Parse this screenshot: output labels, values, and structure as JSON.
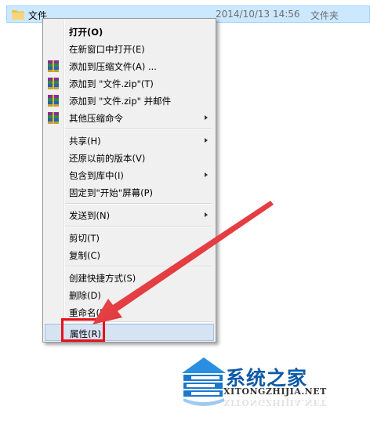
{
  "file": {
    "name": "文件",
    "date": "2014/10/13 14:56",
    "type": "文件夹"
  },
  "menu": {
    "items": [
      {
        "label": "打开(O)",
        "bold": true
      },
      {
        "label": "在新窗口中打开(E)"
      },
      {
        "label": "添加到压缩文件(A) ...",
        "icon": "winrar-icon"
      },
      {
        "label": "添加到 \"文件.zip\"(T)",
        "icon": "winrar-icon"
      },
      {
        "label": "添加到 \"文件.zip\" 并邮件",
        "icon": "winrar-icon"
      },
      {
        "label": "其他压缩命令",
        "icon": "winrar-icon",
        "submenu": true
      },
      {
        "label": "共享(H)",
        "submenu": true
      },
      {
        "label": "还原以前的版本(V)"
      },
      {
        "label": "包含到库中(I)",
        "submenu": true
      },
      {
        "label": "固定到\"开始\"屏幕(P)"
      },
      {
        "label": "发送到(N)",
        "submenu": true
      },
      {
        "label": "剪切(T)"
      },
      {
        "label": "复制(C)"
      },
      {
        "label": "创建快捷方式(S)"
      },
      {
        "label": "删除(D)"
      },
      {
        "label": "重命名(M)"
      },
      {
        "label": "属性(R)",
        "highlighted": true
      }
    ]
  },
  "colors": {
    "selection": "#cce8ff",
    "menu_bg": "#f0f0f0",
    "highlight": "#d5e3f3",
    "annotation_red": "#e8101a",
    "logo_blue": "#0d5aa8"
  },
  "watermark": {
    "title": "系统之家",
    "url": "XITONGZHIJIA.NET"
  }
}
